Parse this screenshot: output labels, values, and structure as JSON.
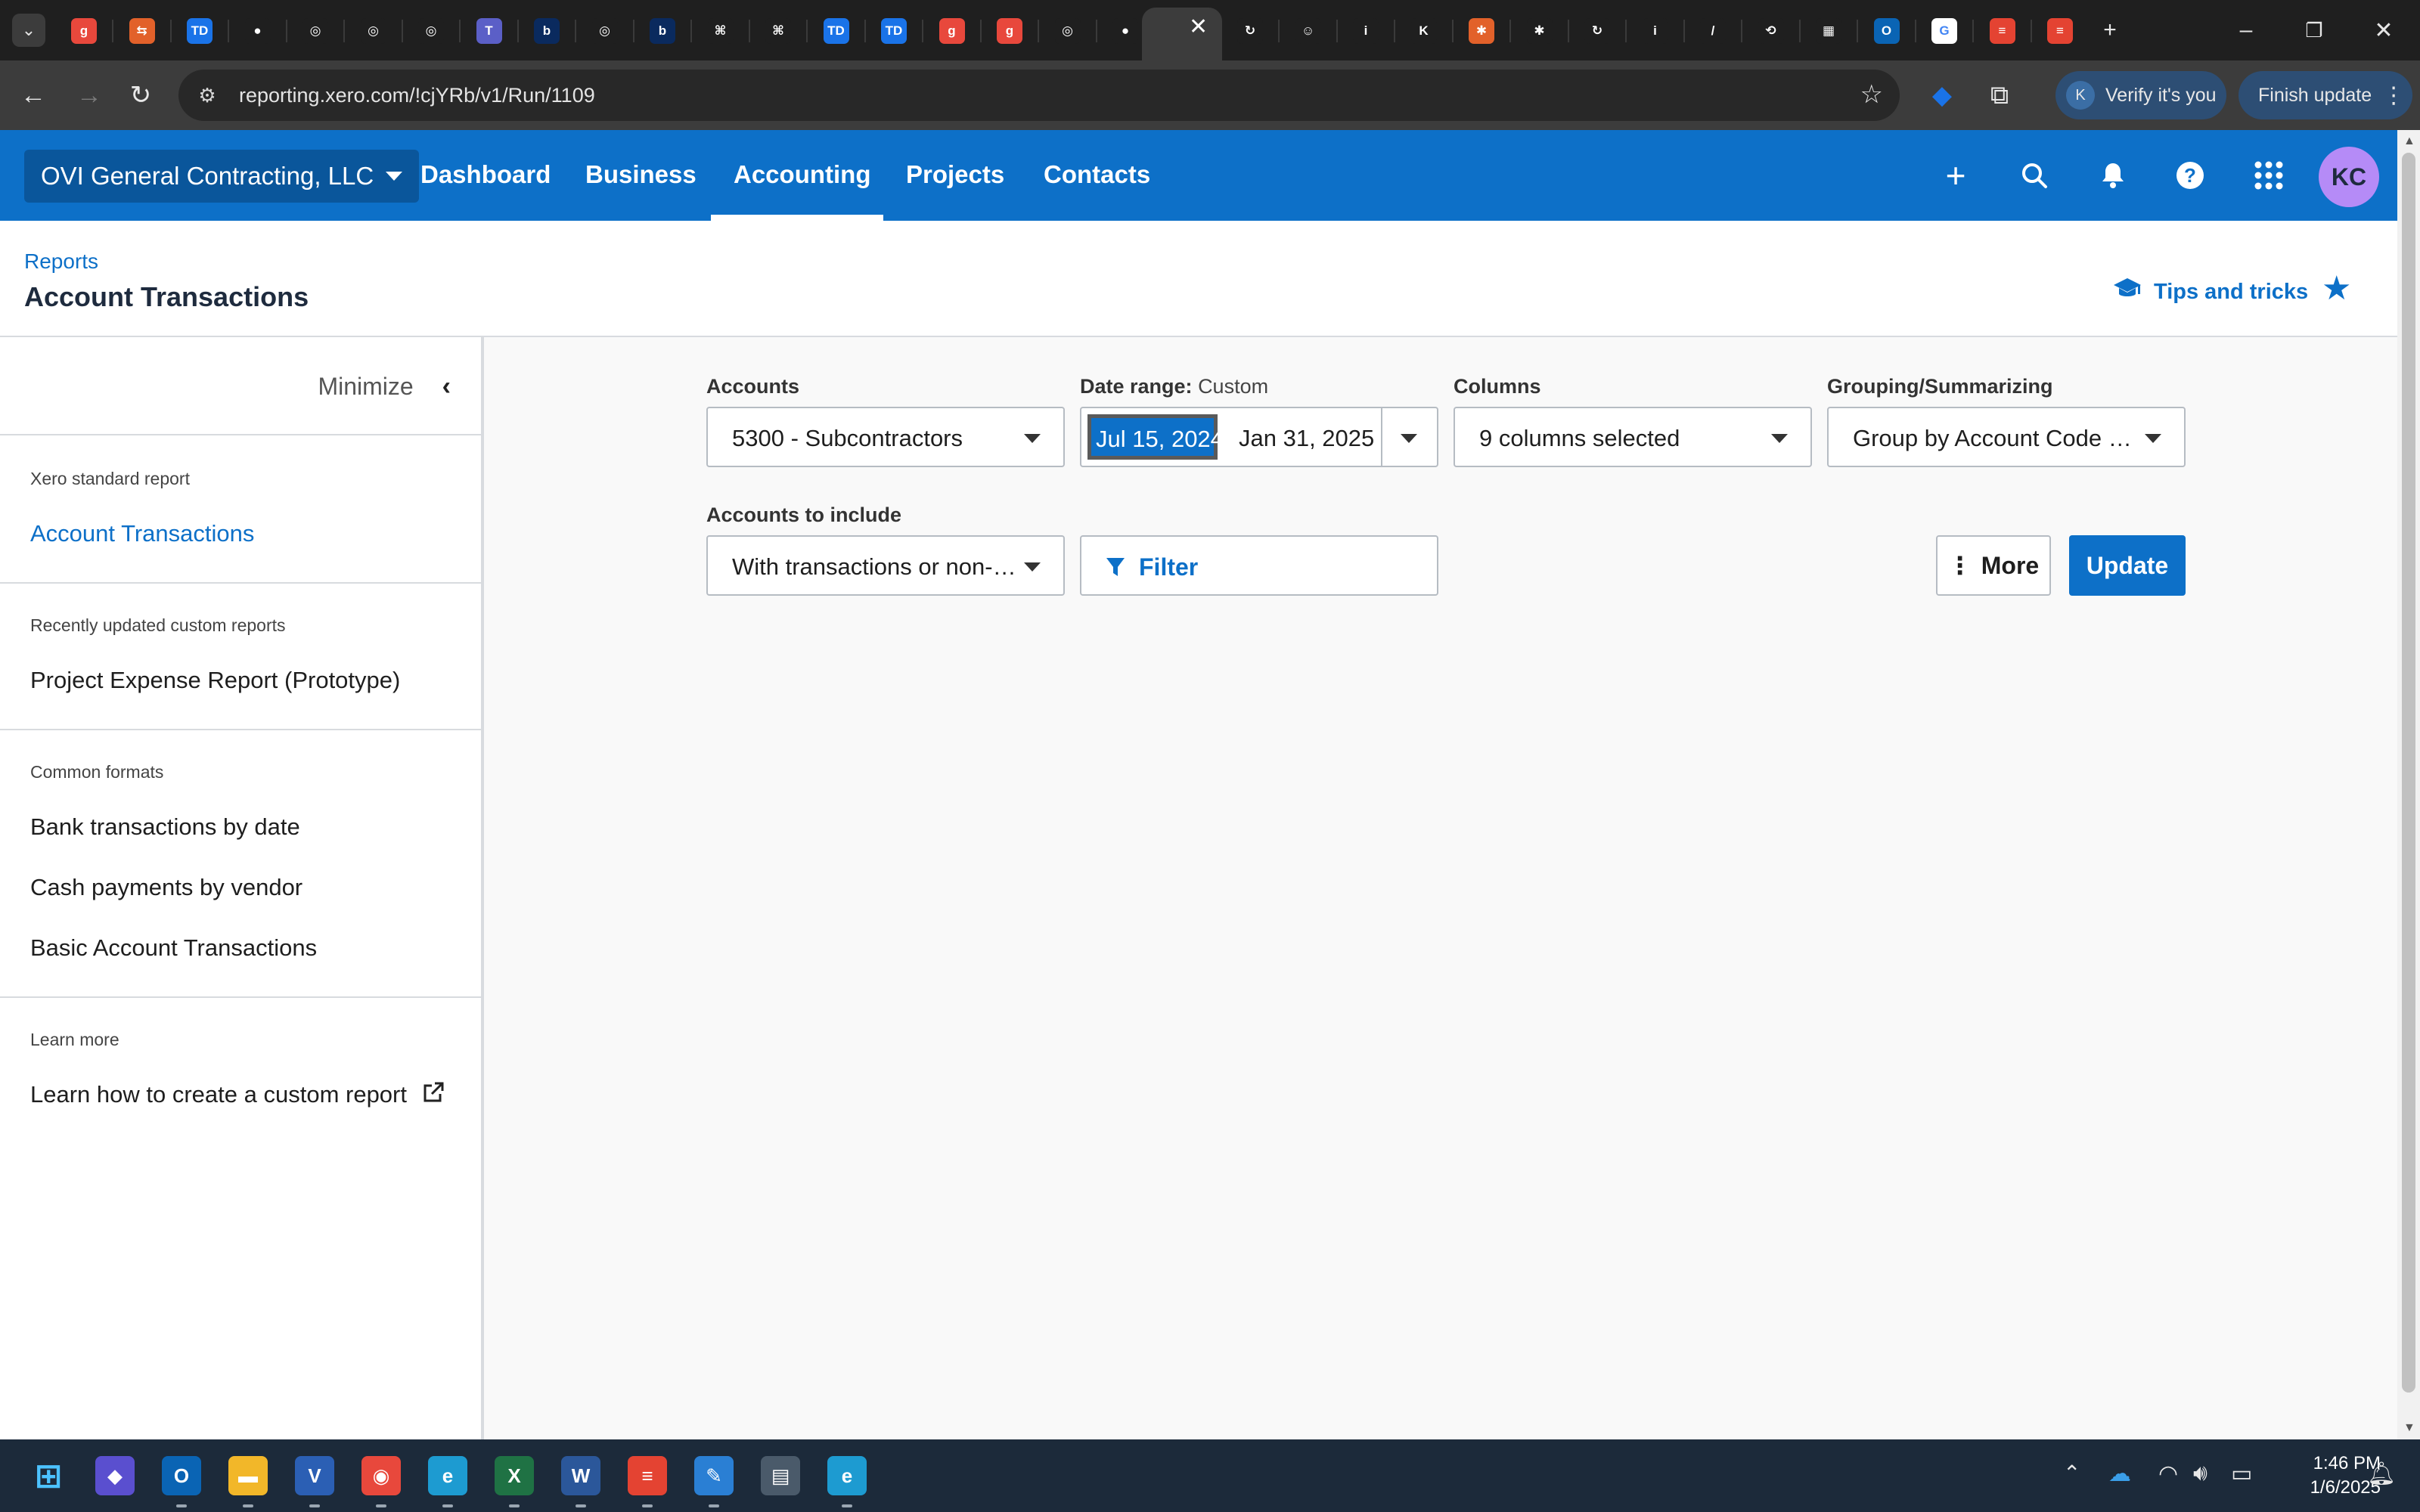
{
  "browser": {
    "url": "reporting.xero.com/!cjYRb/v1/Run/1109",
    "verify_label": "Verify it's you",
    "verify_avatar": "K",
    "finish_update_label": "Finish update",
    "tabs": [
      {
        "icon": "grammarly-icon",
        "glyph": "g",
        "color": "#e8483c"
      },
      {
        "icon": "dev-icon",
        "glyph": "⇆",
        "color": "#e2612a"
      },
      {
        "icon": "td-icon",
        "glyph": "TD",
        "color": "#1a73e8"
      },
      {
        "icon": "record-icon",
        "glyph": "●",
        "color": "#1f1f1f"
      },
      {
        "icon": "globe-icon",
        "glyph": "◎",
        "color": "#1f1f1f"
      },
      {
        "icon": "globe-icon",
        "glyph": "◎",
        "color": "#1f1f1f"
      },
      {
        "icon": "globe-icon",
        "glyph": "◎",
        "color": "#1f1f1f"
      },
      {
        "icon": "teams-icon",
        "glyph": "T",
        "color": "#5b5fc7"
      },
      {
        "icon": "b-icon",
        "glyph": "b",
        "color": "#0a2a5e"
      },
      {
        "icon": "globe-icon",
        "glyph": "◎",
        "color": "#1f1f1f"
      },
      {
        "icon": "b-icon",
        "glyph": "b",
        "color": "#0a2a5e"
      },
      {
        "icon": "grid-app-icon",
        "glyph": "⌘",
        "color": "#1f1f1f"
      },
      {
        "icon": "grid-app-icon",
        "glyph": "⌘",
        "color": "#1f1f1f"
      },
      {
        "icon": "td-icon",
        "glyph": "TD",
        "color": "#1a73e8"
      },
      {
        "icon": "td-icon",
        "glyph": "TD",
        "color": "#1a73e8"
      },
      {
        "icon": "grammarly-icon",
        "glyph": "g",
        "color": "#e8483c"
      },
      {
        "icon": "grammarly-icon",
        "glyph": "g",
        "color": "#e8483c"
      },
      {
        "icon": "globe-icon",
        "glyph": "◎",
        "color": "#1f1f1f"
      },
      {
        "icon": "record-icon",
        "glyph": "●",
        "color": "#1f1f1f"
      }
    ],
    "tabs_right": [
      {
        "icon": "swirl-icon",
        "glyph": "↻",
        "color": "#1f1f1f"
      },
      {
        "icon": "face-icon",
        "glyph": "☺",
        "color": "#1f1f1f"
      },
      {
        "icon": "info-icon",
        "glyph": "i",
        "color": "#1f1f1f"
      },
      {
        "icon": "k-icon",
        "glyph": "K",
        "color": "#1f1f1f"
      },
      {
        "icon": "hubspot-icon",
        "glyph": "✱",
        "color": "#e2612a"
      },
      {
        "icon": "hubspot-icon",
        "glyph": "✱",
        "color": "#1f1f1f"
      },
      {
        "icon": "swirl-icon",
        "glyph": "↻",
        "color": "#1f1f1f"
      },
      {
        "icon": "info-icon",
        "glyph": "i",
        "color": "#1f1f1f"
      },
      {
        "icon": "leaf-icon",
        "glyph": "/",
        "color": "#1f1f1f"
      },
      {
        "icon": "sync-icon",
        "glyph": "⟲",
        "color": "#1f1f1f"
      },
      {
        "icon": "microsoft-icon",
        "glyph": "▦",
        "color": "#1f1f1f"
      },
      {
        "icon": "outlook-icon",
        "glyph": "O",
        "color": "#0a64b4"
      },
      {
        "icon": "google-icon",
        "glyph": "G",
        "color": "#ffffff"
      },
      {
        "icon": "todoist-icon",
        "glyph": "≡",
        "color": "#e44332"
      },
      {
        "icon": "todoist-icon",
        "glyph": "≡",
        "color": "#e44332"
      }
    ]
  },
  "appnav": {
    "org_name": "OVI General Contracting, LLC",
    "links": [
      "Dashboard",
      "Business",
      "Accounting",
      "Projects",
      "Contacts"
    ],
    "active": "Accounting",
    "avatar_initials": "KC"
  },
  "header": {
    "breadcrumb": "Reports",
    "title": "Account Transactions",
    "tips_label": "Tips and tricks"
  },
  "sidebar": {
    "minimize_label": "Minimize",
    "sections": [
      {
        "caption": "Xero standard report",
        "items": [
          "Account Transactions"
        ]
      },
      {
        "caption": "Recently updated custom reports",
        "items": [
          "Project Expense Report (Prototype)"
        ]
      },
      {
        "caption": "Common formats",
        "items": [
          "Bank transactions by date",
          "Cash payments by vendor",
          "Basic Account Transactions"
        ]
      },
      {
        "caption": "Learn more",
        "items": [
          "Learn how to create a custom report"
        ]
      }
    ]
  },
  "filters": {
    "accounts_label": "Accounts",
    "accounts_value": "5300 - Subcontractors",
    "date_range_label": "Date range:",
    "date_range_type": "Custom",
    "date_from": "Jul 15, 2024",
    "date_to": "Jan 31, 2025",
    "columns_label": "Columns",
    "columns_value": "9 columns selected",
    "grouping_label": "Grouping/Summarizing",
    "grouping_value": "Group by Account Code …",
    "include_label": "Accounts to include",
    "include_value": "With transactions or non-…",
    "filter_label": "Filter",
    "more_label": "More",
    "update_label": "Update"
  },
  "taskbar": {
    "time": "1:46 PM",
    "date": "1/6/2025",
    "apps": [
      {
        "icon": "windows-start-icon",
        "glyph": "⊞",
        "color": "#1c2a3a"
      },
      {
        "icon": "copilot-icon",
        "glyph": "◆",
        "color": "#5a4fcf"
      },
      {
        "icon": "outlook-icon",
        "glyph": "O",
        "color": "#0a64b4"
      },
      {
        "icon": "file-explorer-icon",
        "glyph": "▬",
        "color": "#f2b729"
      },
      {
        "icon": "visio-icon",
        "glyph": "V",
        "color": "#2b5fb4"
      },
      {
        "icon": "chrome-icon",
        "glyph": "◉",
        "color": "#e8483c"
      },
      {
        "icon": "edge-icon",
        "glyph": "e",
        "color": "#1d9bd1"
      },
      {
        "icon": "excel-icon",
        "glyph": "X",
        "color": "#1f7244"
      },
      {
        "icon": "word-icon",
        "glyph": "W",
        "color": "#2b579a"
      },
      {
        "icon": "todoist-icon",
        "glyph": "≡",
        "color": "#e44332"
      },
      {
        "icon": "snipping-tool-icon",
        "glyph": "✎",
        "color": "#2a7fd4"
      },
      {
        "icon": "calculator-icon",
        "glyph": "▤",
        "color": "#4a5a6a"
      },
      {
        "icon": "edge-dev-icon",
        "glyph": "e",
        "color": "#1d9bd1"
      }
    ]
  },
  "colors": {
    "xero_blue": "#0d70c8",
    "org_button": "#0a569b",
    "avatar": "#b58bf7"
  }
}
